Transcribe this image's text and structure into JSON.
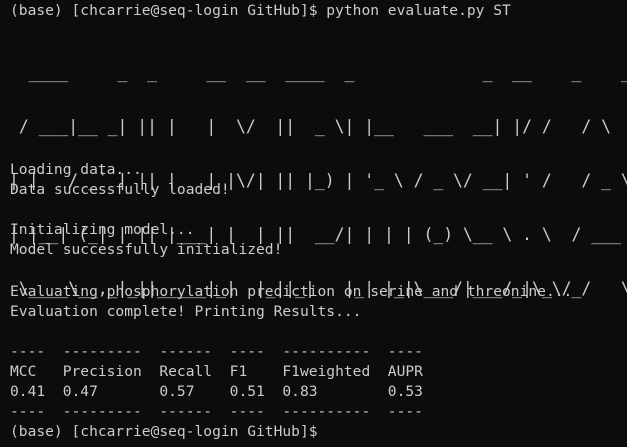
{
  "terminal": {
    "command_line": "(base) [chcarrie@seq-login GitHub]$ python evaluate.py ST",
    "banner": [
      "  ____     _  _     __  __  ____  _             _  __    _    _   _ ",
      " / ___|__ _| || |   |  \\/  ||  _ \\| |__   ___  __| |/ /   / \\  | \\ | |",
      "| |   / _` | || |   | |\\/| || |_) | '_ \\ / _ \\/ __| ' /   / _ \\ |  \\| |",
      "| |__| (_| | || |___| |  | ||  __/| | | | (_) \\__ \\ . \\  / ___ \\| |\\  |",
      " \\____\\__,_|_||_____|_|  |_||_|   |_| |_|\\___/|___/_|\\_\\/_/   \\_\\_| \\_|"
    ],
    "messages": [
      "Loading data...",
      "Data successfully loaded!",
      "",
      "Initializing model...",
      "Model successfully initialized!",
      "",
      "Evaluating phosphorylation prediction on serine and threonine...",
      "Evaluation complete! Printing Results..."
    ],
    "results_table": {
      "separator": "----  ---------  ------  ----  ----------  ----",
      "header": "MCC   Precision  Recall  F1    F1weighted  AUPR",
      "values": "0.41  0.47       0.57    0.51  0.83        0.53",
      "columns": [
        "MCC",
        "Precision",
        "Recall",
        "F1",
        "F1weighted",
        "AUPR"
      ],
      "row": [
        "0.41",
        "0.47",
        "0.57",
        "0.51",
        "0.83",
        "0.53"
      ]
    },
    "final_prompt": "(base) [chcarrie@seq-login GitHub]$"
  },
  "colors": {
    "background": "#0c0c0c",
    "foreground": "#cccccc"
  }
}
